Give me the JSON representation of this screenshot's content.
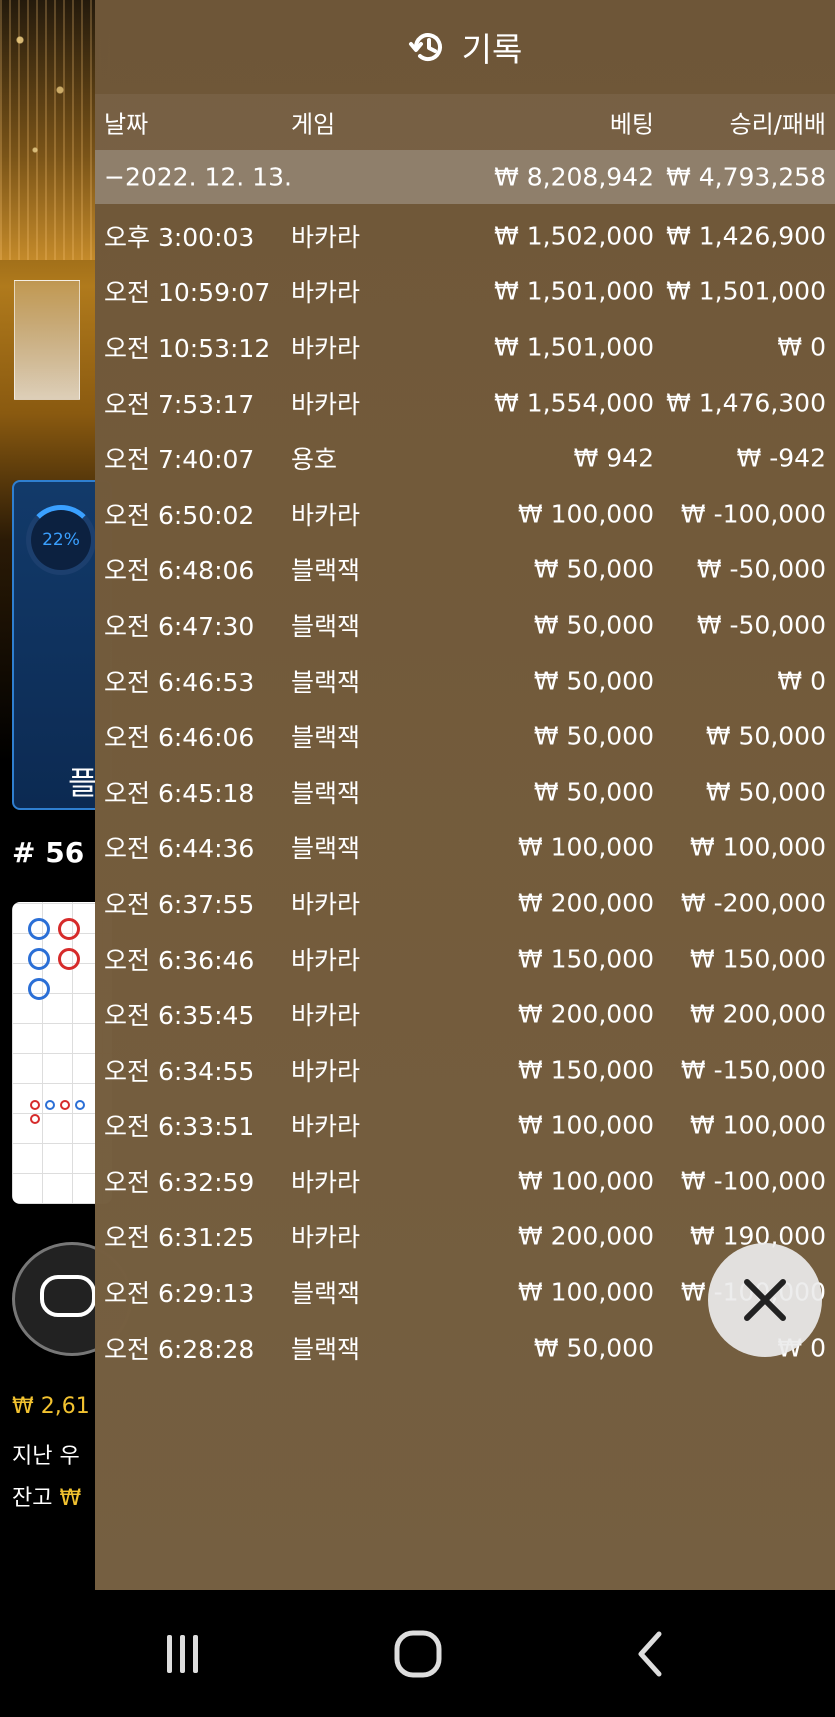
{
  "background": {
    "progress_percent": "22%",
    "progress_label": "플",
    "round_number": "# 56",
    "balance_line": "₩ 2,61",
    "last_win_label": "지난 우",
    "balance_label": "잔고",
    "balance_currency": "₩"
  },
  "overlay": {
    "title": "기록",
    "icon": "history-icon",
    "columns": {
      "date": "날짜",
      "game": "게임",
      "bet": "베팅",
      "win_loss": "승리/패배"
    },
    "date_group": {
      "label": "−2022. 12. 13.",
      "total_bet": "₩ 8,208,942",
      "total_win": "₩ 4,793,258"
    },
    "rows": [
      {
        "time": "오후 3:00:03",
        "game": "바카라",
        "bet": "₩ 1,502,000",
        "result": "₩ 1,426,900"
      },
      {
        "time": "오전 10:59:07",
        "game": "바카라",
        "bet": "₩ 1,501,000",
        "result": "₩ 1,501,000"
      },
      {
        "time": "오전 10:53:12",
        "game": "바카라",
        "bet": "₩ 1,501,000",
        "result": "₩ 0"
      },
      {
        "time": "오전 7:53:17",
        "game": "바카라",
        "bet": "₩ 1,554,000",
        "result": "₩ 1,476,300"
      },
      {
        "time": "오전 7:40:07",
        "game": "용호",
        "bet": "₩ 942",
        "result": "₩ -942"
      },
      {
        "time": "오전 6:50:02",
        "game": "바카라",
        "bet": "₩ 100,000",
        "result": "₩ -100,000"
      },
      {
        "time": "오전 6:48:06",
        "game": "블랙잭",
        "bet": "₩ 50,000",
        "result": "₩ -50,000"
      },
      {
        "time": "오전 6:47:30",
        "game": "블랙잭",
        "bet": "₩ 50,000",
        "result": "₩ -50,000"
      },
      {
        "time": "오전 6:46:53",
        "game": "블랙잭",
        "bet": "₩ 50,000",
        "result": "₩ 0"
      },
      {
        "time": "오전 6:46:06",
        "game": "블랙잭",
        "bet": "₩ 50,000",
        "result": "₩ 50,000"
      },
      {
        "time": "오전 6:45:18",
        "game": "블랙잭",
        "bet": "₩ 50,000",
        "result": "₩ 50,000"
      },
      {
        "time": "오전 6:44:36",
        "game": "블랙잭",
        "bet": "₩ 100,000",
        "result": "₩ 100,000"
      },
      {
        "time": "오전 6:37:55",
        "game": "바카라",
        "bet": "₩ 200,000",
        "result": "₩ -200,000"
      },
      {
        "time": "오전 6:36:46",
        "game": "바카라",
        "bet": "₩ 150,000",
        "result": "₩ 150,000"
      },
      {
        "time": "오전 6:35:45",
        "game": "바카라",
        "bet": "₩ 200,000",
        "result": "₩ 200,000"
      },
      {
        "time": "오전 6:34:55",
        "game": "바카라",
        "bet": "₩ 150,000",
        "result": "₩ -150,000"
      },
      {
        "time": "오전 6:33:51",
        "game": "바카라",
        "bet": "₩ 100,000",
        "result": "₩ 100,000"
      },
      {
        "time": "오전 6:32:59",
        "game": "바카라",
        "bet": "₩ 100,000",
        "result": "₩ -100,000"
      },
      {
        "time": "오전 6:31:25",
        "game": "바카라",
        "bet": "₩ 200,000",
        "result": "₩ 190,000"
      },
      {
        "time": "오전 6:29:13",
        "game": "블랙잭",
        "bet": "₩ 100,000",
        "result": "₩ -100,000"
      },
      {
        "time": "오전 6:28:28",
        "game": "블랙잭",
        "bet": "₩ 50,000",
        "result": "₩ 0"
      }
    ],
    "close_icon": "close-icon"
  },
  "navbar": {
    "recent_icon": "recent-apps-icon",
    "home_icon": "home-icon",
    "back_icon": "back-icon"
  },
  "colors": {
    "overlay_bg": "#76603e",
    "date_group_bg": "#a89e94",
    "balance_gold": "#f2c230",
    "progress_blue": "#3aa0ff"
  }
}
